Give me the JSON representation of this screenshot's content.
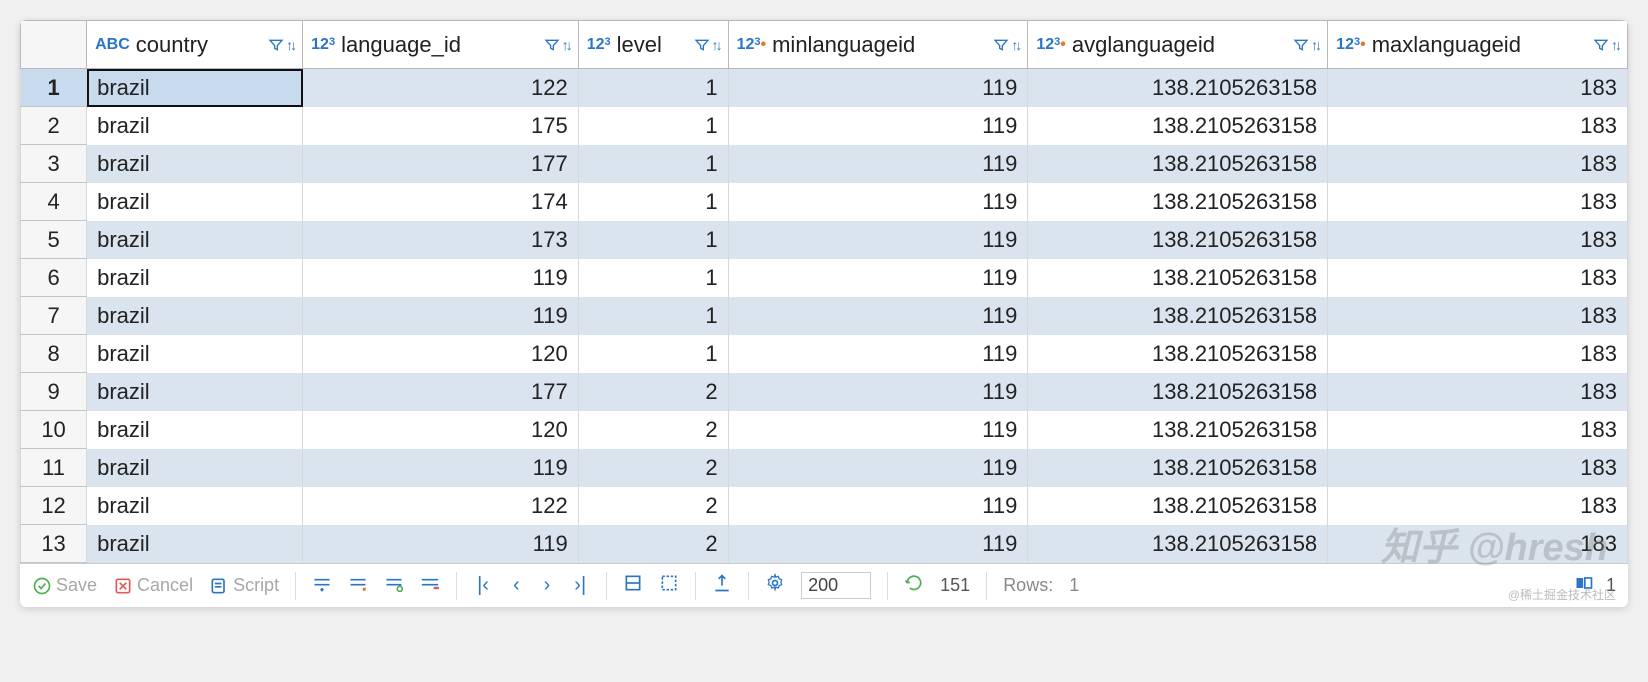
{
  "columns": [
    {
      "name": "country",
      "type": "ABC",
      "align": "txt"
    },
    {
      "name": "language_id",
      "type": "123",
      "align": "num"
    },
    {
      "name": "level",
      "type": "123",
      "align": "num"
    },
    {
      "name": "minlanguageid",
      "type": "123dot",
      "align": "num"
    },
    {
      "name": "avglanguageid",
      "type": "123dot",
      "align": "num"
    },
    {
      "name": "maxlanguageid",
      "type": "123dot",
      "align": "num"
    }
  ],
  "rows": [
    {
      "n": "1",
      "country": "brazil",
      "language_id": "122",
      "level": "1",
      "minlanguageid": "119",
      "avglanguageid": "138.2105263158",
      "maxlanguageid": "183"
    },
    {
      "n": "2",
      "country": "brazil",
      "language_id": "175",
      "level": "1",
      "minlanguageid": "119",
      "avglanguageid": "138.2105263158",
      "maxlanguageid": "183"
    },
    {
      "n": "3",
      "country": "brazil",
      "language_id": "177",
      "level": "1",
      "minlanguageid": "119",
      "avglanguageid": "138.2105263158",
      "maxlanguageid": "183"
    },
    {
      "n": "4",
      "country": "brazil",
      "language_id": "174",
      "level": "1",
      "minlanguageid": "119",
      "avglanguageid": "138.2105263158",
      "maxlanguageid": "183"
    },
    {
      "n": "5",
      "country": "brazil",
      "language_id": "173",
      "level": "1",
      "minlanguageid": "119",
      "avglanguageid": "138.2105263158",
      "maxlanguageid": "183"
    },
    {
      "n": "6",
      "country": "brazil",
      "language_id": "119",
      "level": "1",
      "minlanguageid": "119",
      "avglanguageid": "138.2105263158",
      "maxlanguageid": "183"
    },
    {
      "n": "7",
      "country": "brazil",
      "language_id": "119",
      "level": "1",
      "minlanguageid": "119",
      "avglanguageid": "138.2105263158",
      "maxlanguageid": "183"
    },
    {
      "n": "8",
      "country": "brazil",
      "language_id": "120",
      "level": "1",
      "minlanguageid": "119",
      "avglanguageid": "138.2105263158",
      "maxlanguageid": "183"
    },
    {
      "n": "9",
      "country": "brazil",
      "language_id": "177",
      "level": "2",
      "minlanguageid": "119",
      "avglanguageid": "138.2105263158",
      "maxlanguageid": "183"
    },
    {
      "n": "10",
      "country": "brazil",
      "language_id": "120",
      "level": "2",
      "minlanguageid": "119",
      "avglanguageid": "138.2105263158",
      "maxlanguageid": "183"
    },
    {
      "n": "11",
      "country": "brazil",
      "language_id": "119",
      "level": "2",
      "minlanguageid": "119",
      "avglanguageid": "138.2105263158",
      "maxlanguageid": "183"
    },
    {
      "n": "12",
      "country": "brazil",
      "language_id": "122",
      "level": "2",
      "minlanguageid": "119",
      "avglanguageid": "138.2105263158",
      "maxlanguageid": "183"
    },
    {
      "n": "13",
      "country": "brazil",
      "language_id": "119",
      "level": "2",
      "minlanguageid": "119",
      "avglanguageid": "138.2105263158",
      "maxlanguageid": "183"
    }
  ],
  "selected_row": "1",
  "footer": {
    "save": "Save",
    "cancel": "Cancel",
    "script": "Script",
    "page_size": "200",
    "total": "151",
    "rows_label": "Rows:",
    "rows_value": "1",
    "right_value": "1"
  },
  "watermark": "知乎 @hresh",
  "watermark2": "@稀土掘金技术社区"
}
